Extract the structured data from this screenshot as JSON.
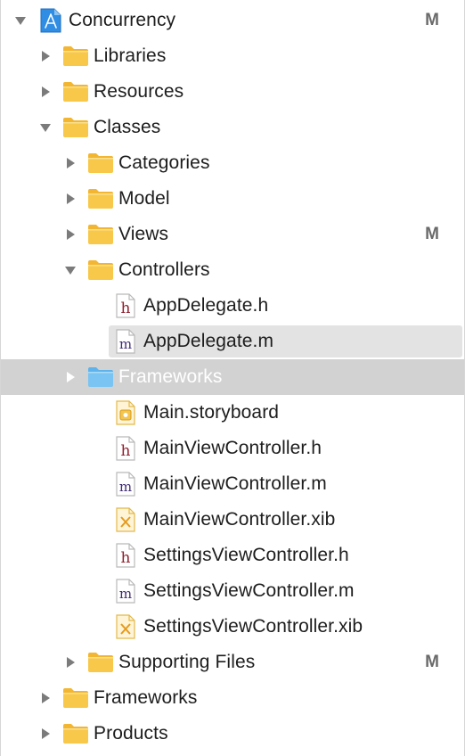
{
  "colors": {
    "folder_fill": "#f8c84a",
    "folder_tab": "#f3b632",
    "folder_blue": "#79c4f3",
    "selected_row": "#e3e3e3",
    "drag_row": "#d2d2d2",
    "badge": "#6a6a6a"
  },
  "tree": [
    {
      "label": "Concurrency",
      "kind": "project",
      "disclosure": "expanded",
      "badge": "M",
      "icon": "xcode-project-icon"
    },
    {
      "label": "Libraries",
      "kind": "folder",
      "disclosure": "collapsed",
      "badge": "",
      "icon": "folder-icon"
    },
    {
      "label": "Resources",
      "kind": "folder",
      "disclosure": "collapsed",
      "badge": "",
      "icon": "folder-icon"
    },
    {
      "label": "Classes",
      "kind": "folder",
      "disclosure": "expanded",
      "badge": "",
      "icon": "folder-icon"
    },
    {
      "label": "Categories",
      "kind": "folder",
      "disclosure": "collapsed",
      "badge": "",
      "icon": "folder-icon"
    },
    {
      "label": "Model",
      "kind": "folder",
      "disclosure": "collapsed",
      "badge": "",
      "icon": "folder-icon"
    },
    {
      "label": "Views",
      "kind": "folder",
      "disclosure": "collapsed",
      "badge": "M",
      "icon": "folder-icon"
    },
    {
      "label": "Controllers",
      "kind": "folder",
      "disclosure": "expanded",
      "badge": "",
      "icon": "folder-icon"
    },
    {
      "label": "AppDelegate.h",
      "kind": "file-h",
      "disclosure": "none",
      "badge": "",
      "icon": "header-file-icon",
      "glyph": "h"
    },
    {
      "label": "AppDelegate.m",
      "kind": "file-m",
      "disclosure": "none",
      "badge": "",
      "icon": "implementation-file-icon",
      "glyph": "m",
      "state": "selected"
    },
    {
      "label": "Frameworks",
      "kind": "folder-blue",
      "disclosure": "collapsed-white",
      "badge": "",
      "icon": "folder-icon",
      "state": "drag"
    },
    {
      "label": "Main.storyboard",
      "kind": "file-storyboard",
      "disclosure": "none",
      "badge": "",
      "icon": "storyboard-file-icon"
    },
    {
      "label": "MainViewController.h",
      "kind": "file-h",
      "disclosure": "none",
      "badge": "",
      "icon": "header-file-icon",
      "glyph": "h"
    },
    {
      "label": "MainViewController.m",
      "kind": "file-m",
      "disclosure": "none",
      "badge": "",
      "icon": "implementation-file-icon",
      "glyph": "m"
    },
    {
      "label": "MainViewController.xib",
      "kind": "file-xib",
      "disclosure": "none",
      "badge": "",
      "icon": "xib-file-icon"
    },
    {
      "label": "SettingsViewController.h",
      "kind": "file-h",
      "disclosure": "none",
      "badge": "",
      "icon": "header-file-icon",
      "glyph": "h"
    },
    {
      "label": "SettingsViewController.m",
      "kind": "file-m",
      "disclosure": "none",
      "badge": "",
      "icon": "implementation-file-icon",
      "glyph": "m"
    },
    {
      "label": "SettingsViewController.xib",
      "kind": "file-xib",
      "disclosure": "none",
      "badge": "",
      "icon": "xib-file-icon"
    },
    {
      "label": "Supporting Files",
      "kind": "folder",
      "disclosure": "collapsed",
      "badge": "M",
      "icon": "folder-icon"
    },
    {
      "label": "Frameworks",
      "kind": "folder",
      "disclosure": "collapsed",
      "badge": "",
      "icon": "folder-icon"
    },
    {
      "label": "Products",
      "kind": "folder",
      "disclosure": "collapsed",
      "badge": "",
      "icon": "folder-icon"
    }
  ]
}
